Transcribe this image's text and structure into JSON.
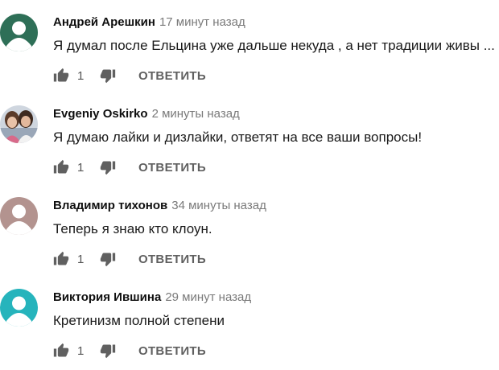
{
  "comments": [
    {
      "author": "Андрей Арешкин",
      "time": "17 минут назад",
      "text": "Я думал после Ельцина уже дальше некуда , а нет традиции живы ...",
      "likes": "1",
      "reply_label": "ОТВЕТИТЬ",
      "avatar": {
        "type": "default",
        "color": "#2e6f57"
      }
    },
    {
      "author": "Evgeniy Oskirko",
      "time": "2 минуты назад",
      "text": "Я думаю лайки и дизлайки, ответят на все ваши вопросы!",
      "likes": "1",
      "reply_label": "ОТВЕТИТЬ",
      "avatar": {
        "type": "photo"
      }
    },
    {
      "author": "Владимир тихонов",
      "time": "34 минуты назад",
      "text": "Теперь я знаю кто клоун.",
      "likes": "1",
      "reply_label": "ОТВЕТИТЬ",
      "avatar": {
        "type": "default",
        "color": "#b3938f"
      }
    },
    {
      "author": "Виктория Ившина",
      "time": "29 минут назад",
      "text": "Кретинизм полной степени",
      "likes": "1",
      "reply_label": "ОТВЕТИТЬ",
      "avatar": {
        "type": "default",
        "color": "#26b4bc"
      }
    }
  ],
  "icons": {
    "like": "thumbs-up-icon",
    "dislike": "thumbs-down-icon"
  },
  "colors": {
    "author": "#0f0f0f",
    "timestamp": "#7a7a7a",
    "icon": "#606060"
  }
}
